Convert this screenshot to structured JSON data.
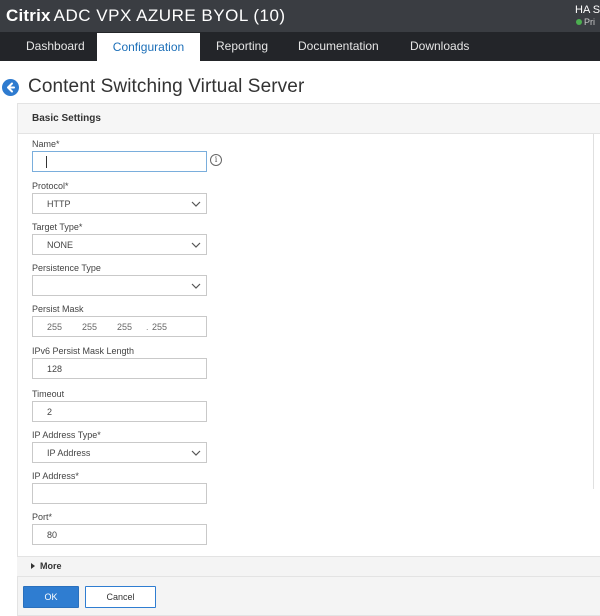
{
  "header": {
    "brand_logo": "Citrix",
    "brand_product": "ADC VPX AZURE BYOL (10)",
    "ha_label": "HA S",
    "ha_status": "Pri",
    "ha_status_color": "#4caf50"
  },
  "nav": {
    "tabs": [
      {
        "label": "Dashboard"
      },
      {
        "label": "Configuration",
        "active": true
      },
      {
        "label": "Reporting"
      },
      {
        "label": "Documentation"
      },
      {
        "label": "Downloads"
      }
    ]
  },
  "page": {
    "title": "Content Switching Virtual Server",
    "back_icon": "back-arrow-icon"
  },
  "panel": {
    "title": "Basic Settings"
  },
  "form": {
    "name": {
      "label": "Name*",
      "value": ""
    },
    "protocol": {
      "label": "Protocol*",
      "value": "HTTP"
    },
    "target_type": {
      "label": "Target Type*",
      "value": "NONE"
    },
    "persistence_type": {
      "label": "Persistence Type",
      "value": ""
    },
    "persist_mask": {
      "label": "Persist Mask",
      "octets": [
        "255",
        "255",
        "255",
        "255"
      ]
    },
    "ipv6_mask": {
      "label": "IPv6 Persist Mask Length",
      "value": "128"
    },
    "timeout": {
      "label": "Timeout",
      "value": "2"
    },
    "ip_address_type": {
      "label": "IP Address Type*",
      "value": "IP Address"
    },
    "ip_address": {
      "label": "IP Address*",
      "value": ""
    },
    "port": {
      "label": "Port*",
      "value": "80"
    }
  },
  "more": {
    "label": "More"
  },
  "footer": {
    "ok_label": "OK",
    "cancel_label": "Cancel"
  },
  "colors": {
    "accent": "#2f7dd1",
    "titlebar": "#3a3d42",
    "navbar": "#232529"
  }
}
